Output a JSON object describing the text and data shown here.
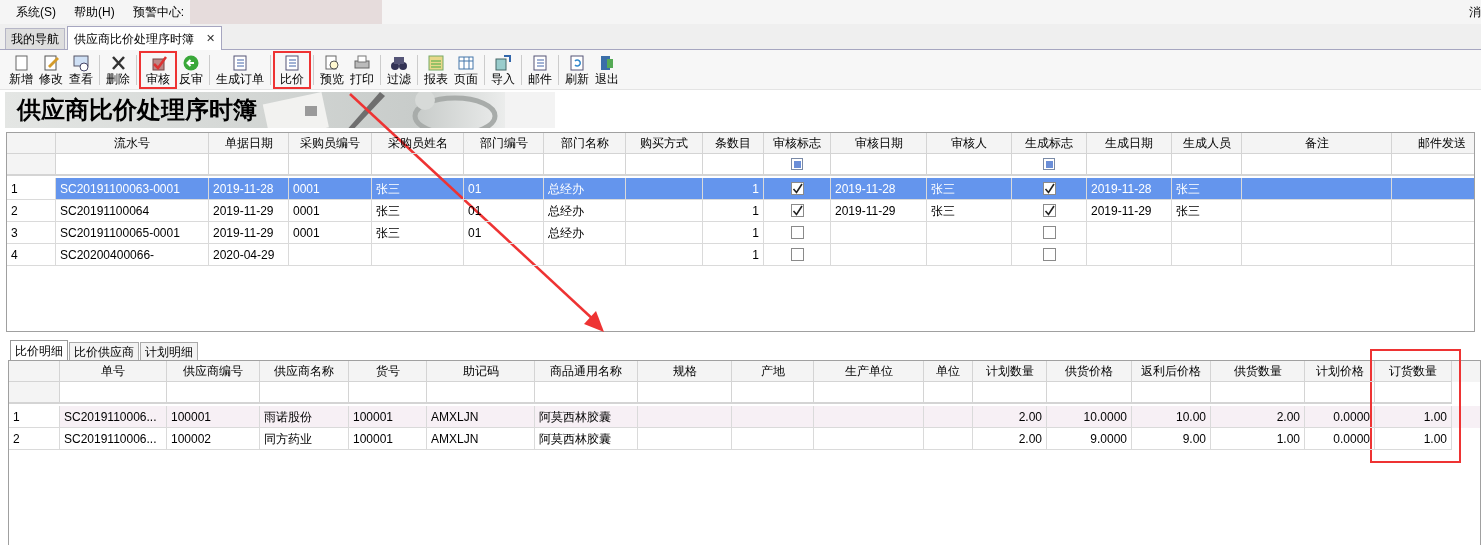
{
  "menu": {
    "items": [
      "系统(S)",
      "帮助(H)",
      "预警中心:"
    ],
    "message": "消"
  },
  "tabs": [
    {
      "label": "我的导航",
      "selected": false,
      "closable": false
    },
    {
      "label": "供应商比价处理序时簿",
      "selected": true,
      "closable": true,
      "close": "✕"
    }
  ],
  "toolbar": [
    [
      {
        "label": "新增",
        "highlighted": false
      },
      {
        "label": "修改",
        "highlighted": false
      },
      {
        "label": "查看",
        "highlighted": false
      }
    ],
    [
      {
        "label": "删除",
        "highlighted": false
      }
    ],
    [
      {
        "label": "审核",
        "highlighted": true
      },
      {
        "label": "反审",
        "highlighted": false
      }
    ],
    [
      {
        "label": "生成订单",
        "highlighted": false
      }
    ],
    [
      {
        "label": "比价",
        "highlighted": true
      }
    ],
    [
      {
        "label": "预览",
        "highlighted": false
      },
      {
        "label": "打印",
        "highlighted": false
      }
    ],
    [
      {
        "label": "过滤",
        "highlighted": false
      }
    ],
    [
      {
        "label": "报表",
        "highlighted": false
      },
      {
        "label": "页面",
        "highlighted": false
      }
    ],
    [
      {
        "label": "导入",
        "highlighted": false
      }
    ],
    [
      {
        "label": "邮件",
        "highlighted": false
      }
    ],
    [
      {
        "label": "刷新",
        "highlighted": false
      },
      {
        "label": "退出",
        "highlighted": false
      }
    ]
  ],
  "banner": {
    "title": "供应商比价处理序时簿"
  },
  "master_table": {
    "columns": [
      {
        "label": "流水号",
        "kind": "text"
      },
      {
        "label": "单据日期",
        "kind": "text"
      },
      {
        "label": "采购员编号",
        "kind": "text"
      },
      {
        "label": "采购员姓名",
        "kind": "text"
      },
      {
        "label": "部门编号",
        "kind": "text"
      },
      {
        "label": "部门名称",
        "kind": "text"
      },
      {
        "label": "购买方式",
        "kind": "text"
      },
      {
        "label": "条数目",
        "kind": "number"
      },
      {
        "label": "审核标志",
        "kind": "check",
        "filter_indeterminate": true
      },
      {
        "label": "审核日期",
        "kind": "text"
      },
      {
        "label": "审核人",
        "kind": "text"
      },
      {
        "label": "生成标志",
        "kind": "check",
        "filter_indeterminate": true
      },
      {
        "label": "生成日期",
        "kind": "text"
      },
      {
        "label": "生成人员",
        "kind": "text"
      },
      {
        "label": "备注",
        "kind": "text"
      },
      {
        "label": "邮件发送",
        "kind": "text"
      }
    ],
    "rows": [
      {
        "index": "1",
        "selected": true,
        "cells": [
          "SC20191100063-0001",
          "2019-11-28",
          "0001",
          "张三",
          "01",
          "总经办",
          null,
          "1",
          true,
          "2019-11-28",
          "张三",
          true,
          "2019-11-28",
          "张三",
          null,
          null
        ]
      },
      {
        "index": "2",
        "selected": false,
        "cells": [
          "SC20191100064",
          "2019-11-29",
          "0001",
          "张三",
          "01",
          "总经办",
          null,
          "1",
          true,
          "2019-11-29",
          "张三",
          true,
          "2019-11-29",
          "张三",
          null,
          null
        ]
      },
      {
        "index": "3",
        "selected": false,
        "cells": [
          "SC20191100065-0001",
          "2019-11-29",
          "0001",
          "张三",
          "01",
          "总经办",
          null,
          "1",
          false,
          null,
          null,
          false,
          null,
          null,
          null,
          null
        ]
      },
      {
        "index": "4",
        "selected": false,
        "cells": [
          "SC20200400066-",
          "2020-04-29",
          null,
          null,
          null,
          null,
          null,
          "1",
          false,
          null,
          null,
          false,
          null,
          null,
          null,
          null
        ]
      }
    ]
  },
  "detail_tabs": [
    {
      "label": "比价明细",
      "selected": true
    },
    {
      "label": "比价供应商",
      "selected": false
    },
    {
      "label": "计划明细",
      "selected": false
    }
  ],
  "detail_table": {
    "columns": [
      {
        "label": "单号",
        "kind": "text",
        "highlighted": false
      },
      {
        "label": "供应商编号",
        "kind": "text",
        "highlighted": false
      },
      {
        "label": "供应商名称",
        "kind": "text",
        "highlighted": false
      },
      {
        "label": "货号",
        "kind": "text",
        "highlighted": false
      },
      {
        "label": "助记码",
        "kind": "text",
        "highlighted": false
      },
      {
        "label": "商品通用名称",
        "kind": "text",
        "highlighted": false
      },
      {
        "label": "规格",
        "kind": "text",
        "highlighted": false
      },
      {
        "label": "产地",
        "kind": "text",
        "highlighted": false
      },
      {
        "label": "生产单位",
        "kind": "text",
        "highlighted": false
      },
      {
        "label": "单位",
        "kind": "text",
        "highlighted": false
      },
      {
        "label": "计划数量",
        "kind": "number",
        "highlighted": false
      },
      {
        "label": "供货价格",
        "kind": "number",
        "highlighted": false
      },
      {
        "label": "返利后价格",
        "kind": "number",
        "highlighted": false
      },
      {
        "label": "供货数量",
        "kind": "number",
        "highlighted": false
      },
      {
        "label": "计划价格",
        "kind": "number",
        "highlighted": false
      },
      {
        "label": "订货数量",
        "kind": "number",
        "highlighted": true
      }
    ],
    "rows": [
      {
        "index": "1",
        "selected": true,
        "cells": [
          "SC2019110006...",
          "100001",
          "雨诺股份",
          "100001",
          "AMXLJN",
          "阿莫西林胶囊",
          null,
          null,
          null,
          null,
          "2.00",
          "10.0000",
          "10.00",
          "2.00",
          "0.0000",
          "1.00"
        ]
      },
      {
        "index": "2",
        "selected": false,
        "cells": [
          "SC2019110006...",
          "100002",
          "同方药业",
          "100001",
          "AMXLJN",
          "阿莫西林胶囊",
          null,
          null,
          null,
          null,
          "2.00",
          "9.0000",
          "9.00",
          "1.00",
          "0.0000",
          "1.00"
        ]
      }
    ]
  }
}
